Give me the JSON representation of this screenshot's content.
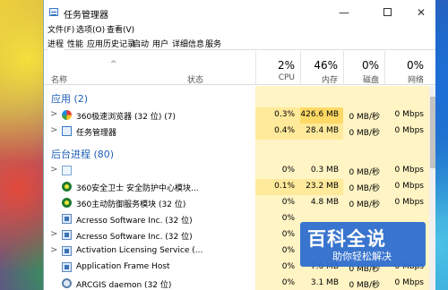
{
  "window": {
    "title": "任务管理器",
    "controls": {
      "minimize": "—",
      "close": "✕"
    }
  },
  "menu": [
    "文件(F)",
    "选项(O)",
    "查看(V)"
  ],
  "tabs": [
    "进程",
    "性能",
    "应用历史记录",
    "启动",
    "用户",
    "详细信息",
    "服务"
  ],
  "columns": {
    "name": "名称",
    "status": "状态",
    "cpu": {
      "percent": "2%",
      "label": "CPU"
    },
    "memory": {
      "percent": "46%",
      "label": "内存"
    },
    "disk": {
      "percent": "0%",
      "label": "磁盘"
    },
    "network": {
      "percent": "0%",
      "label": "网络"
    }
  },
  "sections": {
    "apps": "应用 (2)",
    "background": "后台进程 (80)"
  },
  "app_rows": [
    {
      "name": "360极速浏览器 (32 位) (7)",
      "icon": "360-browser-icon",
      "cpu": "0.3%",
      "memory": "426.6 MB",
      "disk": "0 MB/秒",
      "network": "0 Mbps"
    },
    {
      "name": "任务管理器",
      "icon": "task-manager-icon",
      "cpu": "0.4%",
      "memory": "28.4 MB",
      "disk": "0 MB/秒",
      "network": "0 Mbps"
    }
  ],
  "bg_rows": [
    {
      "name": "",
      "icon": "blank-process-icon",
      "cpu": "0%",
      "memory": "0.3 MB",
      "disk": "0 MB/秒",
      "network": "0 Mbps"
    },
    {
      "name": "360安全卫士 安全防护中心模块...",
      "icon": "360-guard-icon",
      "cpu": "0.1%",
      "memory": "23.2 MB",
      "disk": "0 MB/秒",
      "network": "0 Mbps"
    },
    {
      "name": "360主动防御服务模块 (32 位)",
      "icon": "360-defense-icon",
      "cpu": "0%",
      "memory": "4.8 MB",
      "disk": "0 MB/秒",
      "network": "0 Mbps"
    },
    {
      "name": "Acresso Software Inc. (32 位)",
      "icon": "service-icon",
      "cpu": "0%",
      "memory": "",
      "disk": "",
      "network": ""
    },
    {
      "name": "Acresso Software Inc. (32 位)",
      "icon": "service-icon",
      "cpu": "0%",
      "memory": "",
      "disk": "",
      "network": ""
    },
    {
      "name": "Activation Licensing Service (...",
      "icon": "service-icon",
      "cpu": "0%",
      "memory": "",
      "disk": "",
      "network": ""
    },
    {
      "name": "Application Frame Host",
      "icon": "service-icon",
      "cpu": "0%",
      "memory": "7.6 MB",
      "disk": "0 MB/秒",
      "network": "0 Mbps"
    },
    {
      "name": "ARCGIS daemon (32 位)",
      "icon": "gear-icon",
      "cpu": "0%",
      "memory": "3.1 MB",
      "disk": "0 MB/秒",
      "network": "0 Mbps"
    }
  ],
  "watermark": {
    "title": "百科全说",
    "subtitle": "助你轻松解决"
  },
  "colors": {
    "section_blue": "#1f5fb8",
    "heat_yellow": "#fff4c4"
  }
}
